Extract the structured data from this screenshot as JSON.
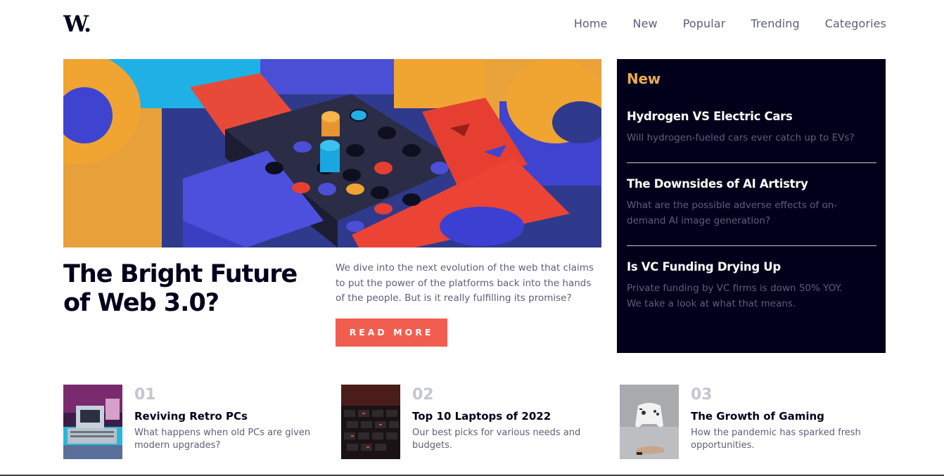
{
  "logo": {
    "text": "W."
  },
  "nav": {
    "items": [
      {
        "label": "Home"
      },
      {
        "label": "New"
      },
      {
        "label": "Popular"
      },
      {
        "label": "Trending"
      },
      {
        "label": "Categories"
      }
    ]
  },
  "hero": {
    "title_line1": "The Bright Future",
    "title_line2": "of Web 3.0?",
    "description": "We dive into the next evolution of the web that claims to put the power of the platforms back into the hands of the people. But is it really fulfilling its promise?",
    "button_label": "READ MORE"
  },
  "new_panel": {
    "heading": "New",
    "items": [
      {
        "title": "Hydrogen VS Electric Cars",
        "description": "Will hydrogen-fueled cars ever catch up to EVs?"
      },
      {
        "title": "The Downsides of AI Artistry",
        "description": "What are the possible adverse effects of on-demand AI image generation?"
      },
      {
        "title": "Is VC Funding Drying Up",
        "description": "Private funding by VC firms is down 50% YOY. We take a look at what that means."
      }
    ]
  },
  "bottom": {
    "items": [
      {
        "number": "01",
        "title": "Reviving Retro PCs",
        "description": "What happens when old PCs are given modern upgrades?"
      },
      {
        "number": "02",
        "title": "Top 10 Laptops of 2022",
        "description": "Our best picks for various needs and budgets."
      },
      {
        "number": "03",
        "title": "The Growth of Gaming",
        "description": "How the pandemic has sparked fresh opportunities."
      }
    ]
  },
  "colors": {
    "dark_navy": "#00001a",
    "accent_orange": "#e9ab53",
    "accent_red": "#f15e50",
    "grayish_blue": "#5d5f79",
    "grayish_light": "#c5c6ce"
  }
}
